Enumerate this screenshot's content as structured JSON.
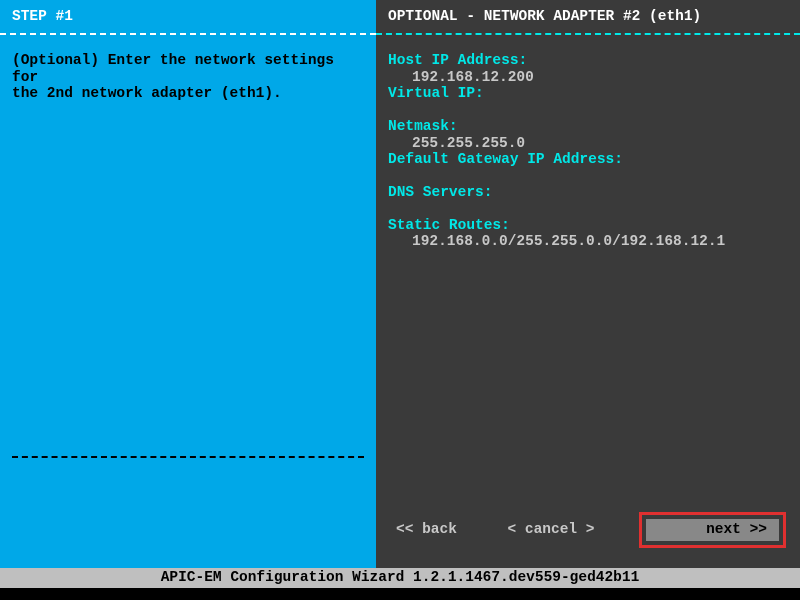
{
  "left": {
    "step_title": "STEP #1",
    "instruction_line1": "(Optional) Enter the network settings for",
    "instruction_line2": "the 2nd network adapter (eth1)."
  },
  "right": {
    "panel_title": "OPTIONAL - NETWORK ADAPTER #2 (eth1)",
    "host_ip_label": "Host IP Address:",
    "host_ip_value": "192.168.12.200",
    "virtual_ip_label": "Virtual IP:",
    "netmask_label": "Netmask:",
    "netmask_value": "255.255.255.0",
    "gateway_label": "Default Gateway IP Address:",
    "dns_label": "DNS Servers:",
    "static_routes_label": "Static Routes:",
    "static_routes_value": "192.168.0.0/255.255.0.0/192.168.12.1"
  },
  "buttons": {
    "back": "<< back",
    "cancel": "< cancel >",
    "next": "next >>"
  },
  "status_bar": "APIC-EM Configuration Wizard 1.2.1.1467.dev559-ged42b11"
}
